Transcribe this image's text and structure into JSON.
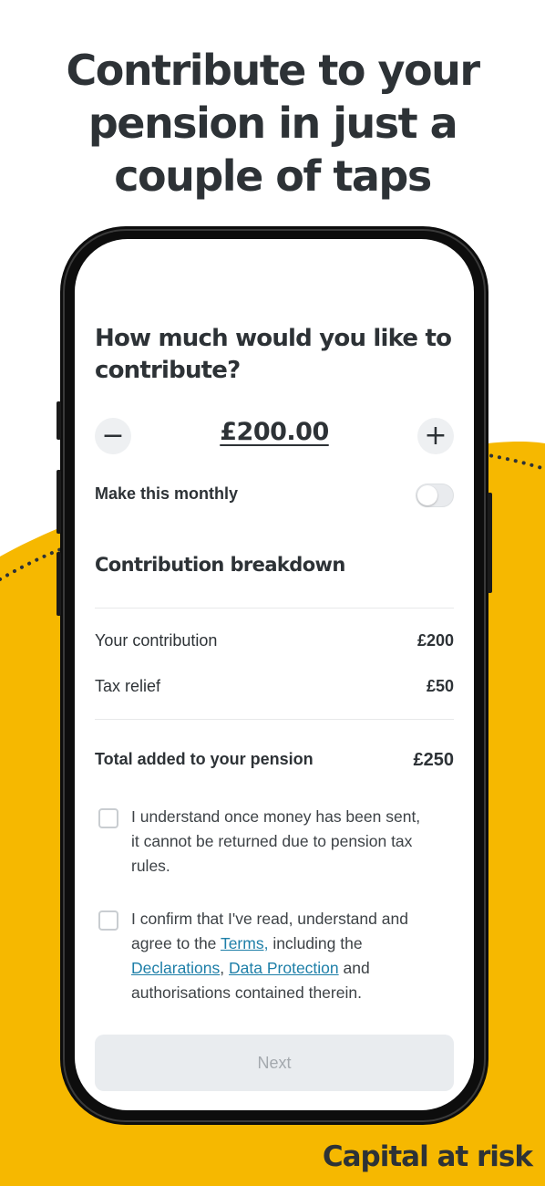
{
  "colors": {
    "brand_yellow": "#f6b800",
    "text_dark": "#2d3236",
    "link_blue": "#1e7fa8",
    "disabled_button": "#e9ecef"
  },
  "headline": {
    "line1": "Contribute to your",
    "line2": "pension in just a",
    "line3": "couple of taps"
  },
  "footer_note": "Capital at risk",
  "screen": {
    "question": "How much would you like to contribute?",
    "decrement_icon": "minus-icon",
    "increment_icon": "plus-icon",
    "decrement_symbol": "−",
    "increment_symbol": "+",
    "amount": "£200.00",
    "monthly_toggle": {
      "label": "Make this monthly",
      "on": false
    },
    "breakdown": {
      "title": "Contribution breakdown",
      "rows": [
        {
          "label": "Your contribution",
          "value": "£200"
        },
        {
          "label": "Tax relief",
          "value": "£50"
        }
      ],
      "total": {
        "label": "Total added to your pension",
        "value": "£250"
      }
    },
    "confirmations": {
      "item1": {
        "text": "I understand once money has been sent, it cannot be returned due to pension tax rules.",
        "checked": false
      },
      "item2": {
        "checked": false,
        "part1": "I confirm that I've read, understand and agree to the ",
        "terms_link": "Terms,",
        "part2": " including the ",
        "declarations_link": "Declarations",
        "comma": ", ",
        "data_protection_link": "Data Protection",
        "part3": " and authorisations contained therein."
      }
    },
    "next_button": "Next"
  }
}
